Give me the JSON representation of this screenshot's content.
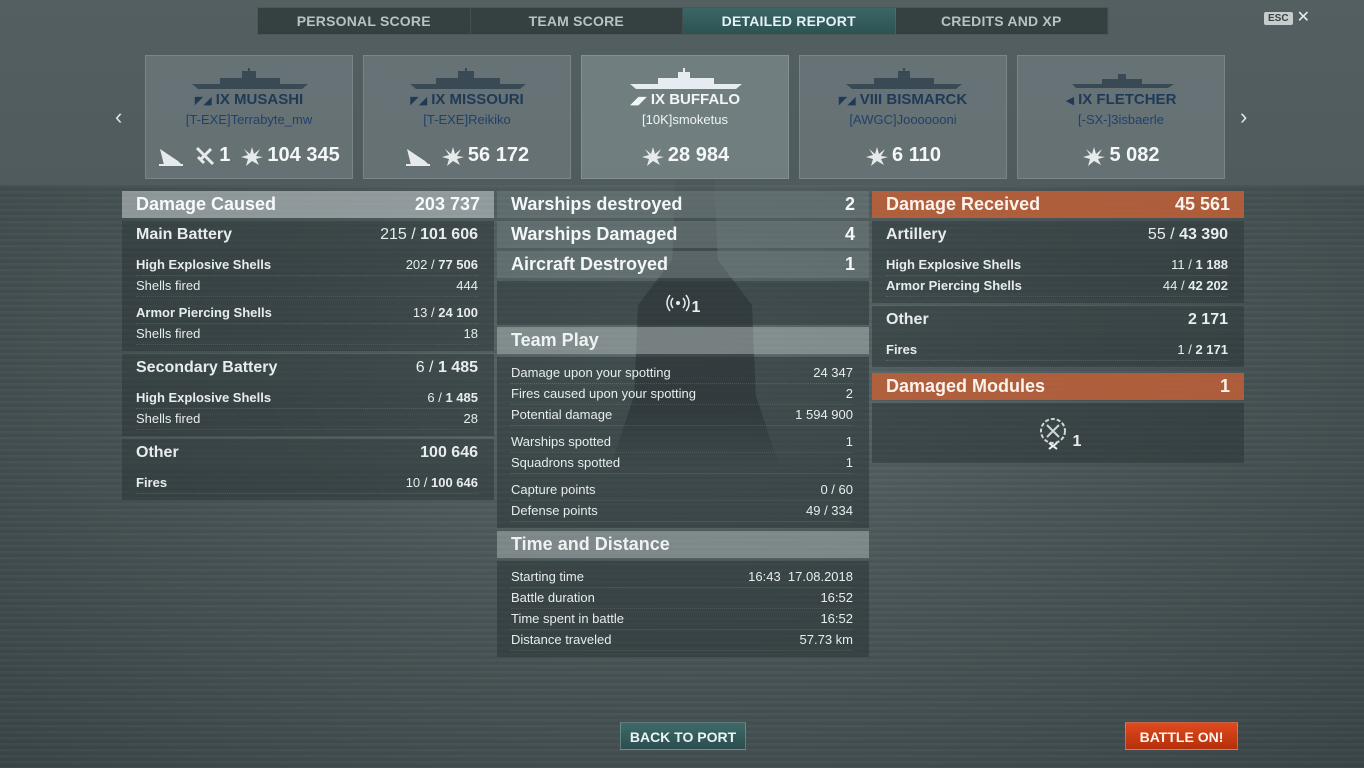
{
  "tabs": [
    {
      "label": "PERSONAL SCORE"
    },
    {
      "label": "TEAM SCORE"
    },
    {
      "label": "DETAILED REPORT"
    },
    {
      "label": "CREDITS AND XP"
    }
  ],
  "esc": {
    "key": "ESC",
    "close": "✕"
  },
  "nav": {
    "left": "‹",
    "right": "›"
  },
  "ships": [
    {
      "tier_name": "IX MUSASHI",
      "player": "[T-EXE]Terrabyte_mw",
      "stats": [
        {
          "icon": "sinking-icon",
          "value": ""
        },
        {
          "icon": "plane-down-icon",
          "value": "1"
        },
        {
          "icon": "damage-icon",
          "value": "104 345"
        }
      ]
    },
    {
      "tier_name": "IX MISSOURI",
      "player": "[T-EXE]Reikiko",
      "stats": [
        {
          "icon": "sinking-icon",
          "value": ""
        },
        {
          "icon": "damage-icon",
          "value": "56 172"
        }
      ]
    },
    {
      "tier_name": "IX BUFFALO",
      "player": "[10K]smoketus",
      "stats": [
        {
          "icon": "damage-icon",
          "value": "28 984"
        }
      ]
    },
    {
      "tier_name": "VIII BISMARCK",
      "player": "[AWGC]Jooooooni",
      "stats": [
        {
          "icon": "damage-icon",
          "value": "6 110"
        }
      ]
    },
    {
      "tier_name": "IX FLETCHER",
      "player": "[-SX-]3isbaerle",
      "stats": [
        {
          "icon": "damage-icon",
          "value": "5 082"
        }
      ]
    }
  ],
  "damage_caused": {
    "title": "Damage Caused",
    "total": "203 737",
    "main_battery": {
      "label": "Main Battery",
      "hits": "215",
      "dmg": "101 606"
    },
    "mb_he": {
      "label": "High Explosive Shells",
      "hits": "202",
      "dmg": "77 506"
    },
    "mb_he_fired": {
      "label": "Shells fired",
      "value": "444"
    },
    "mb_ap": {
      "label": "Armor Piercing Shells",
      "hits": "13",
      "dmg": "24 100"
    },
    "mb_ap_fired": {
      "label": "Shells fired",
      "value": "18"
    },
    "secondary": {
      "label": "Secondary Battery",
      "hits": "6",
      "dmg": "1 485"
    },
    "sec_he": {
      "label": "High Explosive Shells",
      "hits": "6",
      "dmg": "1 485"
    },
    "sec_he_fired": {
      "label": "Shells fired",
      "value": "28"
    },
    "other": {
      "label": "Other",
      "value": "100 646"
    },
    "fires": {
      "label": "Fires",
      "hits": "10",
      "dmg": "100 646"
    }
  },
  "destroyed": {
    "warships_destroyed": {
      "label": "Warships destroyed",
      "value": "2"
    },
    "warships_damaged": {
      "label": "Warships Damaged",
      "value": "4"
    },
    "aircraft_destroyed": {
      "label": "Aircraft Destroyed",
      "value": "1"
    },
    "ribbon_count": "1"
  },
  "team_play": {
    "title": "Team Play",
    "rows": [
      {
        "label": "Damage upon your spotting",
        "value": "24 347"
      },
      {
        "label": "Fires caused upon your spotting",
        "value": "2"
      },
      {
        "label": "Potential damage",
        "value": "1 594 900"
      },
      {
        "label": "Warships spotted",
        "value": "1"
      },
      {
        "label": "Squadrons spotted",
        "value": "1"
      },
      {
        "label": "Capture points",
        "value": "0 / 60"
      },
      {
        "label": "Defense points",
        "value": "49 / 334"
      }
    ]
  },
  "time_distance": {
    "title": "Time and Distance",
    "rows": [
      {
        "label": "Starting time",
        "value": "16:43  17.08.2018"
      },
      {
        "label": "Battle duration",
        "value": "16:52"
      },
      {
        "label": "Time spent in battle",
        "value": "16:52"
      },
      {
        "label": "Distance traveled",
        "value": "57.73 km"
      }
    ]
  },
  "damage_received": {
    "title": "Damage Received",
    "total": "45 561",
    "artillery": {
      "label": "Artillery",
      "hits": "55",
      "dmg": "43 390"
    },
    "art_he": {
      "label": "High Explosive Shells",
      "hits": "11",
      "dmg": "1 188"
    },
    "art_ap": {
      "label": "Armor Piercing Shells",
      "hits": "44",
      "dmg": "42 202"
    },
    "other": {
      "label": "Other",
      "value": "2 171"
    },
    "fires": {
      "label": "Fires",
      "hits": "1",
      "dmg": "2 171"
    }
  },
  "damaged_modules": {
    "label": "Damaged Modules",
    "value": "1",
    "icon_count": "1"
  },
  "buttons": {
    "back": "BACK TO PORT",
    "battle": "BATTLE ON!"
  },
  "colors": {
    "accent_teal": "#2d5252",
    "received_orange": "#c46036",
    "battle_red": "#c93a12"
  }
}
